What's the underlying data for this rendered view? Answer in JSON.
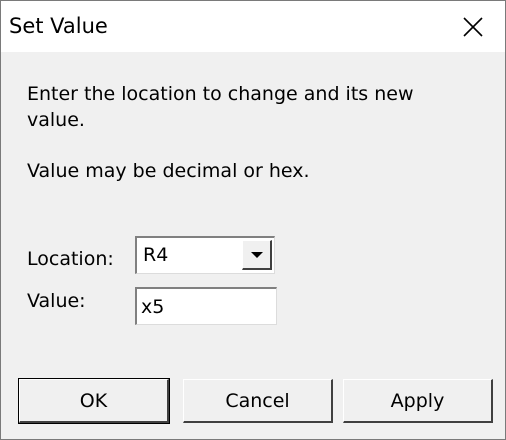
{
  "window": {
    "title": "Set Value"
  },
  "icons": {
    "close": "close-icon",
    "dropdown": "chevron-down-icon"
  },
  "content": {
    "description": "Enter the location to change and its new value.",
    "note": "Value may be decimal or hex."
  },
  "form": {
    "location_label": "Location:",
    "location_value": "R4",
    "value_label": "Value:",
    "value_input": "x5"
  },
  "buttons": {
    "ok": "OK",
    "cancel": "Cancel",
    "apply": "Apply"
  }
}
